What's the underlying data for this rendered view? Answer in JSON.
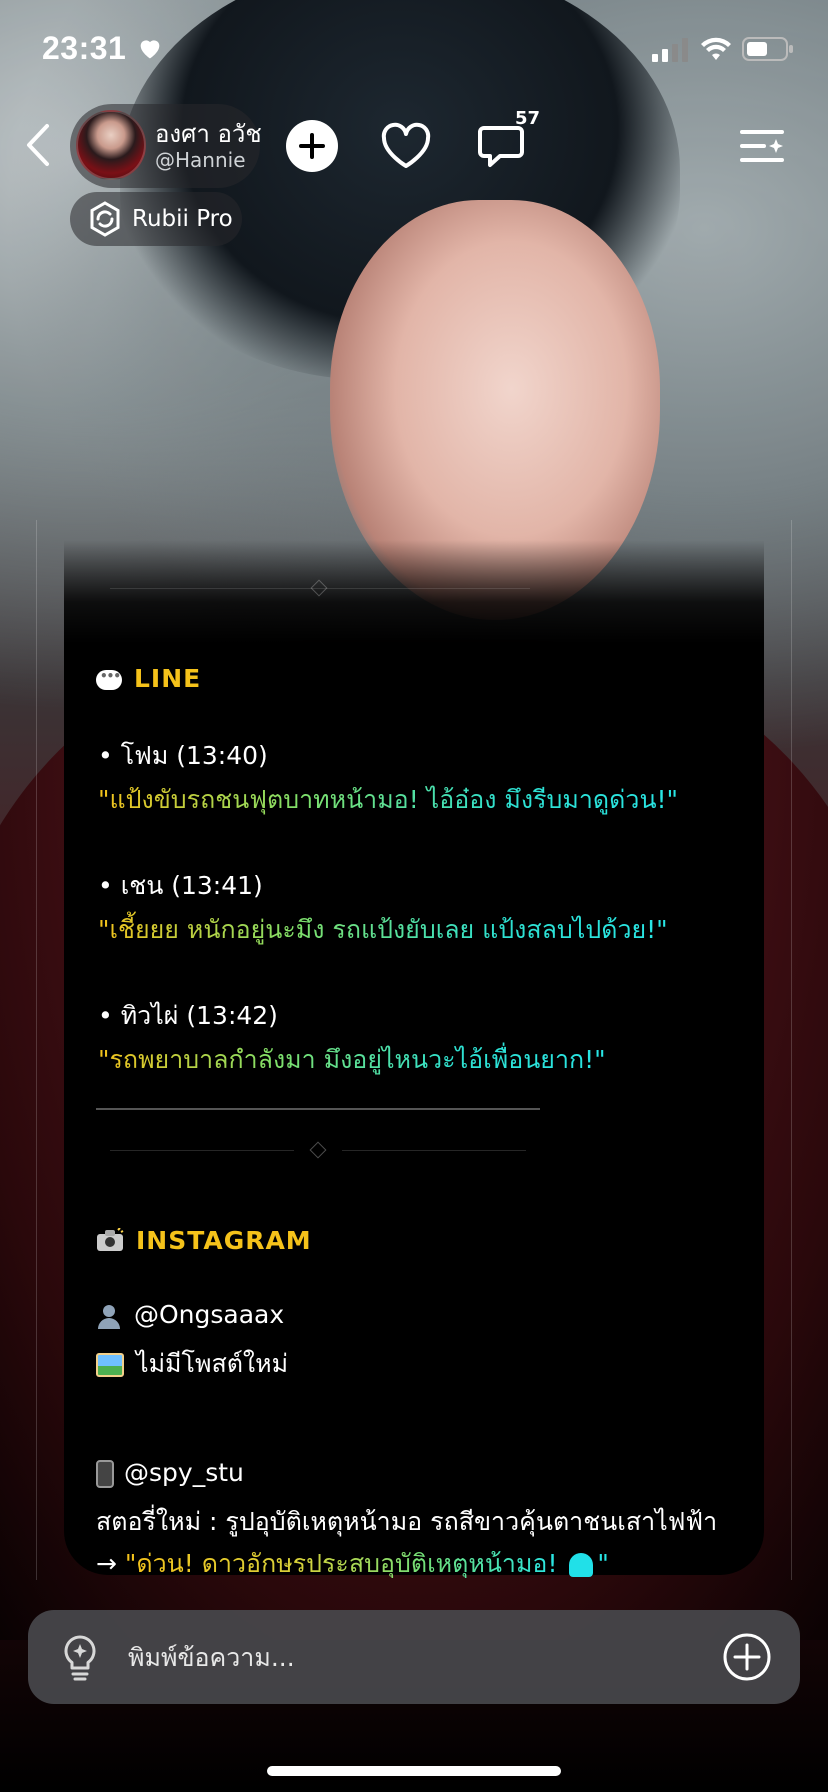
{
  "status_bar": {
    "time": "23:31"
  },
  "header": {
    "name": "องศา อวัช",
    "handle": "@Hannie",
    "comment_count": "57",
    "badge_label": "Rubii Pro"
  },
  "message": {
    "line_section": {
      "title": "LINE",
      "entries": [
        {
          "speaker": "• โฟม (13:40)",
          "quote": "\"แป้งขับรถชนฟุตบาทหน้ามอ! ไอ้อ๋อง มึงรีบมาดูด่วน!\""
        },
        {
          "speaker": "• เชน (13:41)",
          "quote": "\"เชี้ยยย หนักอยู่นะมึง รถแป้งยับเลย แป้งสลบไปด้วย!\""
        },
        {
          "speaker": "• ทิวไผ่ (13:42)",
          "quote": "\"รถพยาบาลกำลังมา มึงอยู่ไหนวะไอ้เพื่อนยาก!\""
        }
      ]
    },
    "instagram_section": {
      "title": "INSTAGRAM",
      "account": "@Ongsaaax",
      "no_posts": "ไม่มีโพสต์ใหม่",
      "spy_account": "@spy_stu",
      "story": "สตอรี่ใหม่ : รูปอุบัติเหตุหน้ามอ รถสีขาวคุ้นตาชนเสาไฟฟ้า",
      "arrow": "→",
      "headline": "\"ด่วน! ดาวอักษรประสบอุบัติเหตุหน้ามอ!",
      "headline_end": "\""
    }
  },
  "composer": {
    "placeholder": "พิมพ์ข้อความ..."
  },
  "colors": {
    "section_title": "#f5c21a",
    "quote_start": "#f5c21a",
    "quote_end": "#28e6e6",
    "composer_bg": "#48484c"
  }
}
